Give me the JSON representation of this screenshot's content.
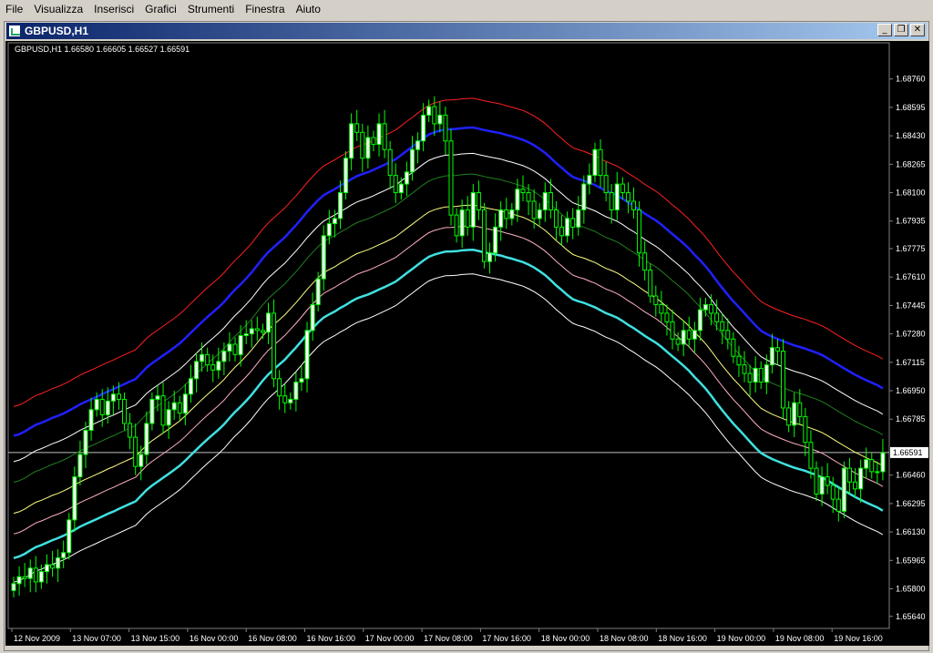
{
  "menu": [
    {
      "label": "File"
    },
    {
      "label": "Visualizza"
    },
    {
      "label": "Inserisci"
    },
    {
      "label": "Grafici"
    },
    {
      "label": "Strumenti"
    },
    {
      "label": "Finestra"
    },
    {
      "label": "Aiuto"
    }
  ],
  "window": {
    "title": "GBPUSD,H1",
    "ohlc": "GBPUSD,H1  1.66580 1.66605 1.66527 1.66591"
  },
  "chart_data": {
    "type": "candlestick",
    "symbol": "GBPUSD",
    "timeframe": "H1",
    "current_price": "1.66591",
    "y_ticks": [
      "1.68760",
      "1.68595",
      "1.68430",
      "1.68265",
      "1.68100",
      "1.67935",
      "1.67775",
      "1.67610",
      "1.67445",
      "1.67280",
      "1.67115",
      "1.66950",
      "1.66785",
      "1.66460",
      "1.66295",
      "1.66130",
      "1.65965",
      "1.65800",
      "1.65640"
    ],
    "ylim": [
      1.6557,
      1.6897
    ],
    "x_ticks": [
      "12 Nov 2009",
      "13 Nov 07:00",
      "13 Nov 15:00",
      "16 Nov 00:00",
      "16 Nov 08:00",
      "16 Nov 16:00",
      "17 Nov 00:00",
      "17 Nov 08:00",
      "17 Nov 16:00",
      "18 Nov 00:00",
      "18 Nov 08:00",
      "18 Nov 16:00",
      "19 Nov 00:00",
      "19 Nov 08:00",
      "19 Nov 16:00"
    ],
    "candle_color": "#00ff00",
    "bull_fill": "#ffffff",
    "bear_fill": "#000000",
    "close": [
      1.6583,
      1.6587,
      1.6586,
      1.6592,
      1.6584,
      1.659,
      1.6594,
      1.6592,
      1.6598,
      1.6601,
      1.662,
      1.6645,
      1.6658,
      1.6672,
      1.6684,
      1.669,
      1.6681,
      1.6689,
      1.6693,
      1.669,
      1.6676,
      1.6668,
      1.6651,
      1.6658,
      1.6676,
      1.669,
      1.6692,
      1.6675,
      1.6684,
      1.6688,
      1.6682,
      1.6693,
      1.6702,
      1.6712,
      1.6716,
      1.671,
      1.6707,
      1.6712,
      1.6718,
      1.6722,
      1.6716,
      1.6727,
      1.6728,
      1.6731,
      1.673,
      1.6729,
      1.674,
      1.6702,
      1.6692,
      1.6688,
      1.669,
      1.67,
      1.6702,
      1.673,
      1.6745,
      1.676,
      1.6785,
      1.6792,
      1.6795,
      1.681,
      1.683,
      1.685,
      1.6845,
      1.683,
      1.6842,
      1.6838,
      1.685,
      1.6835,
      1.682,
      1.681,
      1.6815,
      1.6822,
      1.6835,
      1.684,
      1.6855,
      1.686,
      1.685,
      1.6855,
      1.684,
      1.6797,
      1.6785,
      1.68,
      1.679,
      1.681,
      1.68,
      1.677,
      1.6775,
      1.679,
      1.68,
      1.6795,
      1.68,
      1.6812,
      1.681,
      1.6805,
      1.6795,
      1.68,
      1.681,
      1.68,
      1.679,
      1.6785,
      1.6795,
      1.679,
      1.68,
      1.6815,
      1.682,
      1.6835,
      1.682,
      1.681,
      1.68,
      1.6815,
      1.681,
      1.6805,
      1.68,
      1.6775,
      1.6765,
      1.675,
      1.6745,
      1.674,
      1.6735,
      1.6725,
      1.6722,
      1.673,
      1.6725,
      1.673,
      1.6742,
      1.6745,
      1.674,
      1.6735,
      1.673,
      1.6725,
      1.6715,
      1.671,
      1.6705,
      1.67,
      1.6708,
      1.67,
      1.671,
      1.672,
      1.6718,
      1.6685,
      1.6675,
      1.6688,
      1.668,
      1.6665,
      1.665,
      1.6635,
      1.6645,
      1.664,
      1.6632,
      1.6625,
      1.665,
      1.6642,
      1.6638,
      1.665,
      1.6655,
      1.6648,
      1.6648,
      1.6659
    ]
  }
}
